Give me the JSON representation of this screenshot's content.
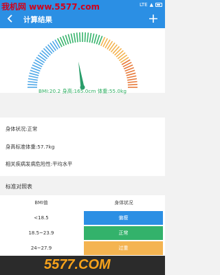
{
  "status_bar": {
    "watermark": "我机网 www.5577.com",
    "network": "LTE",
    "icons": [
      "signal-icon",
      "battery-icon"
    ]
  },
  "app_bar": {
    "title": "计算结果",
    "back_icon": "back-arrow-icon",
    "add_icon": "plus-icon",
    "color": "#2b8fe4"
  },
  "gauge": {
    "needle_fraction": 0.45,
    "colors": [
      "#4fa8e8",
      "#36b36b",
      "#f4b451",
      "#e87a3a"
    ]
  },
  "stats": {
    "bmi": "BMI:20.2",
    "height": "身高:165.0cm",
    "weight": "体重:55.0kg"
  },
  "info": {
    "status": "身体状况:正常",
    "standard_weight": "身高标准体重:57.7kg",
    "risk": "相关疾病发病危险性:平均水平"
  },
  "table": {
    "title": "标准对照表",
    "headers": [
      "BMI值",
      "身体状况"
    ],
    "rows": [
      {
        "range": "<18.5",
        "status": "偏瘦",
        "color": "#2b8fe4"
      },
      {
        "range": "18.5~23.9",
        "status": "正常",
        "color": "#33b26b"
      },
      {
        "range": "24~27.9",
        "status": "过重",
        "color": "#f4b451"
      }
    ]
  },
  "bottom_watermark": "5577.COM"
}
